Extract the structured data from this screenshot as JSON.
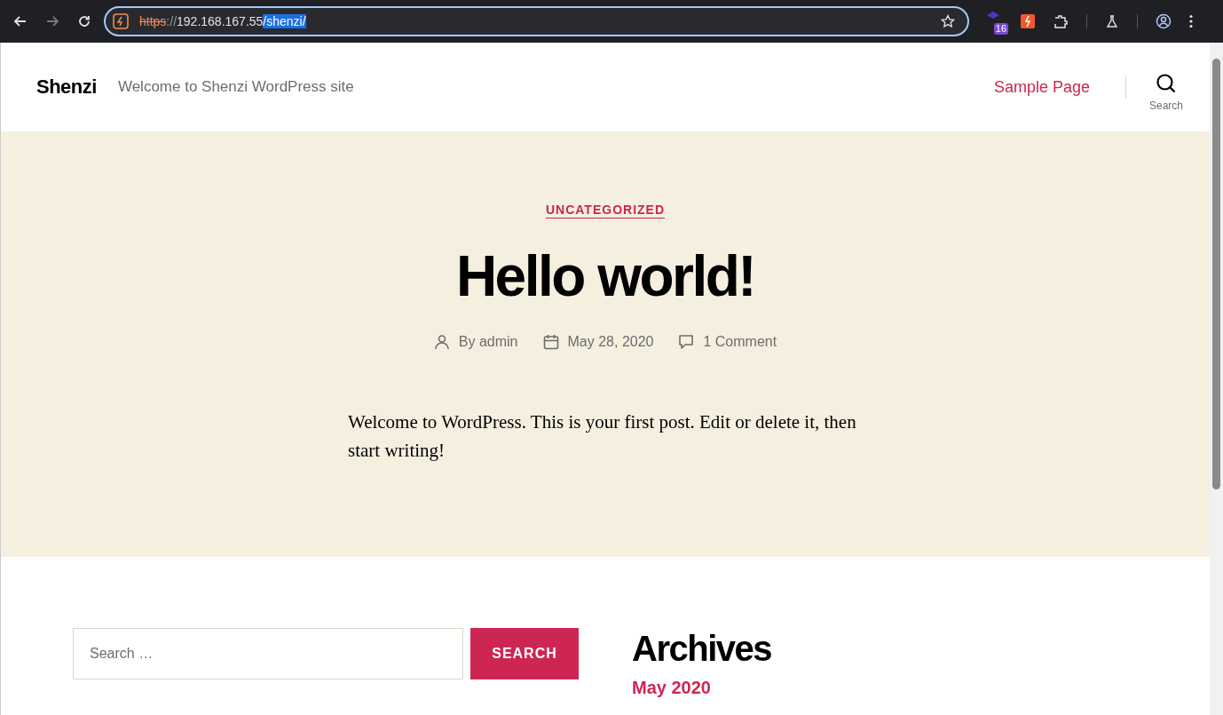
{
  "browser": {
    "url": {
      "scheme": "https",
      "separator": "://",
      "host": "192.168.167.55",
      "path": "/shenzi/",
      "insecure": true,
      "path_selected": true
    },
    "extension_badge": "16"
  },
  "site": {
    "title": "Shenzi",
    "tagline": "Welcome to Shenzi WordPress site",
    "nav": [
      {
        "label": "Sample Page"
      }
    ],
    "search_label": "Search"
  },
  "post": {
    "category": "UNCATEGORIZED",
    "title": "Hello world!",
    "meta": [
      {
        "kind": "author",
        "text": "By admin"
      },
      {
        "kind": "date",
        "text": "May 28, 2020"
      },
      {
        "kind": "comments",
        "text": "1 Comment"
      }
    ],
    "body": "Welcome to WordPress. This is your first post. Edit or delete it, then start writing!"
  },
  "widgets": {
    "search": {
      "placeholder": "Search …",
      "button": "SEARCH"
    },
    "archives": {
      "title": "Archives",
      "items": [
        "May 2020"
      ]
    }
  }
}
